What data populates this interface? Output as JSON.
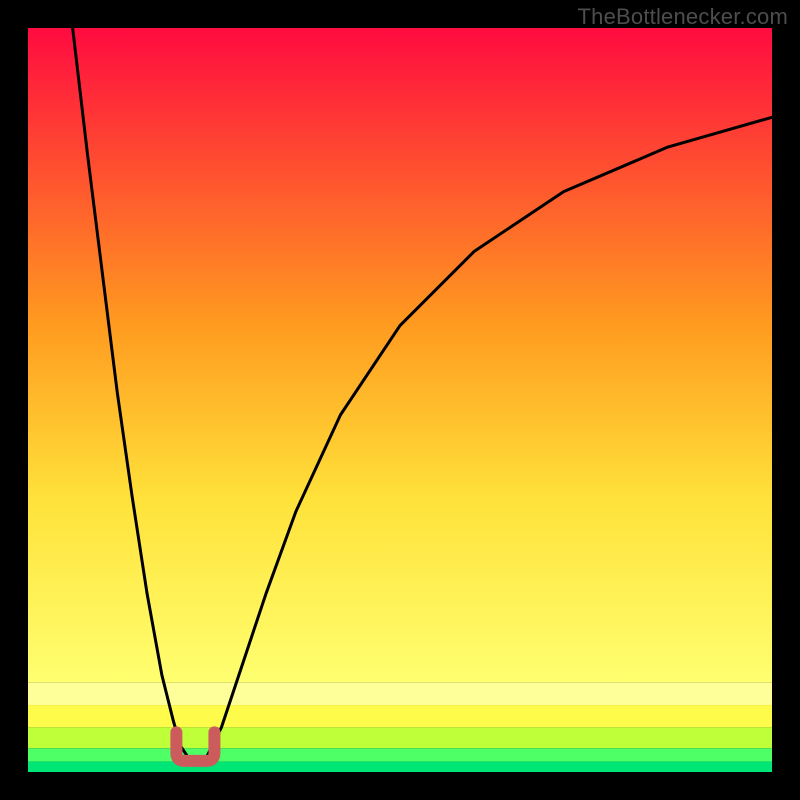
{
  "watermark": "TheBottlenecker.com",
  "colors": {
    "top": "#ff0b40",
    "band_yellow_light": "#ffff99",
    "band_yellow": "#fffb4a",
    "band_lime": "#bfff3a",
    "band_green_light": "#4fff66",
    "band_green": "#00e676",
    "curve": "#000000",
    "marker": "#cc5c5c",
    "frame": "#000000"
  },
  "chart_data": {
    "type": "line",
    "title": "",
    "xlabel": "",
    "ylabel": "",
    "xlim": [
      0,
      100
    ],
    "ylim": [
      0,
      100
    ],
    "series": [
      {
        "name": "bottleneck-curve-left",
        "x": [
          6,
          8,
          10,
          12,
          14,
          16,
          18,
          19.5,
          20.5,
          21.5
        ],
        "values": [
          100,
          83,
          67,
          51,
          37,
          24,
          13,
          7,
          3.5,
          2
        ]
      },
      {
        "name": "bottleneck-curve-right",
        "x": [
          24,
          26,
          28,
          32,
          36,
          42,
          50,
          60,
          72,
          86,
          100
        ],
        "values": [
          2,
          6,
          12,
          24,
          35,
          48,
          60,
          70,
          78,
          84,
          88
        ]
      }
    ],
    "marker": {
      "name": "u-bottom",
      "x": 22.5,
      "y": 2,
      "width": 3.5,
      "height": 3.5
    },
    "bands": [
      {
        "name": "green",
        "y_from": 0,
        "y_to": 1.5
      },
      {
        "name": "lime",
        "y_from": 1.5,
        "y_to": 4
      },
      {
        "name": "yellow",
        "y_from": 4,
        "y_to": 12
      },
      {
        "name": "gradient",
        "y_from": 12,
        "y_to": 100
      }
    ]
  }
}
